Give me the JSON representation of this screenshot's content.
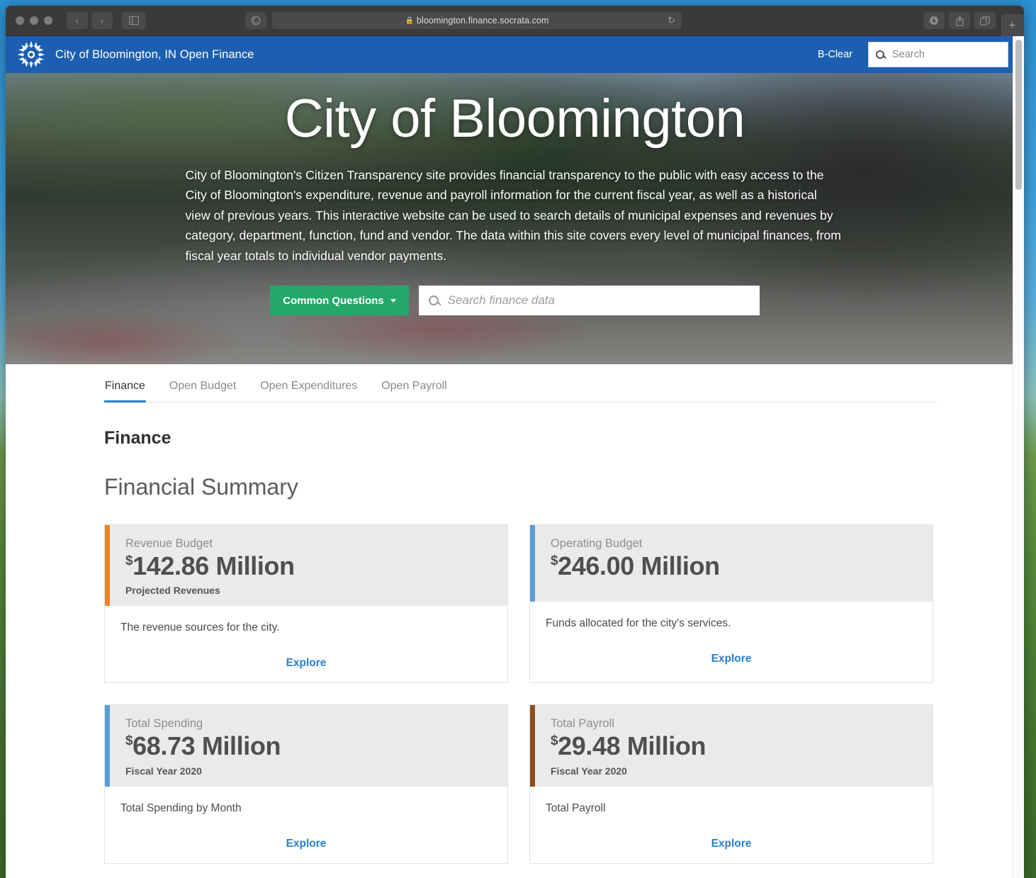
{
  "browser": {
    "url": "bloomington.finance.socrata.com",
    "lock_icon": "lock-icon",
    "back_icon": "‹",
    "forward_icon": "›",
    "sidebar_icon": "sidebar-icon",
    "reader_icon": "reader-icon",
    "reload_icon": "↻",
    "download_icon": "download-icon",
    "share_icon": "share-icon",
    "tabs_icon": "tabs-overview-icon",
    "new_tab_label": "+"
  },
  "site_header": {
    "title": "City of Bloomington, IN Open Finance",
    "logo_name": "city-seal-logo",
    "bclear_label": "B-Clear",
    "search_placeholder": "Search",
    "search_value": "",
    "bg_color": "#1c5fb0"
  },
  "hero": {
    "title": "City of Bloomington",
    "description": "City of Bloomington's Citizen Transparency site provides financial transparency to the public with easy access to the City of Bloomington's expenditure, revenue and payroll information for the current fiscal year, as well as a historical view of previous years. This interactive website can be used to search details of municipal expenses and revenues by category, department, function, fund and vendor. The data within this site covers every level of municipal finances, from fiscal year totals to individual vendor payments.",
    "common_questions_label": "Common Questions",
    "search_placeholder": "Search finance data",
    "search_value": "",
    "button_color": "#23a86a"
  },
  "tabs": [
    {
      "label": "Finance",
      "active": true
    },
    {
      "label": "Open Budget",
      "active": false
    },
    {
      "label": "Open Expenditures",
      "active": false
    },
    {
      "label": "Open Payroll",
      "active": false
    }
  ],
  "page": {
    "section_title": "Finance",
    "summary_title": "Financial Summary"
  },
  "cards": [
    {
      "label": "Revenue Budget",
      "currency": "$",
      "value": "142.86 Million",
      "sub": "Projected Revenues",
      "description": "The revenue sources for the city.",
      "link": "Explore",
      "accent": "#f08123"
    },
    {
      "label": "Operating Budget",
      "currency": "$",
      "value": "246.00 Million",
      "sub": "",
      "description": "Funds allocated for the city's services.",
      "link": "Explore",
      "accent": "#5a9fd4"
    },
    {
      "label": "Total Spending",
      "currency": "$",
      "value": "68.73 Million",
      "sub": "Fiscal Year 2020",
      "description": "Total Spending by Month",
      "link": "Explore",
      "accent": "#5a9fd4"
    },
    {
      "label": "Total Payroll",
      "currency": "$",
      "value": "29.48 Million",
      "sub": "Fiscal Year 2020",
      "description": "Total Payroll",
      "link": "Explore",
      "accent": "#8b4e1e"
    }
  ]
}
